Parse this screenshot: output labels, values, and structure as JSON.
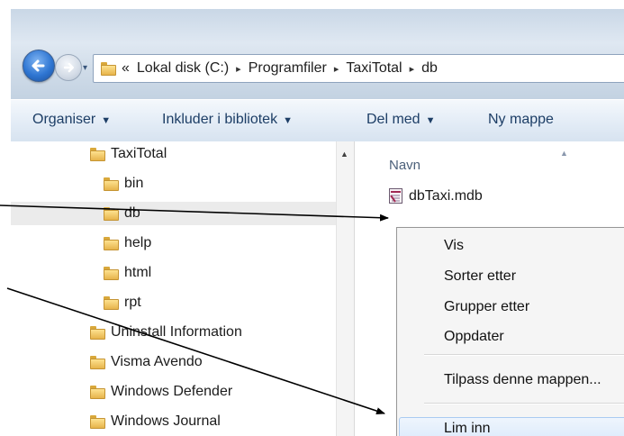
{
  "nav": {
    "history_glyph": "▾"
  },
  "address": {
    "overflow": "«",
    "crumbs": [
      "Lokal disk (C:)",
      "Programfiler",
      "TaxiTotal",
      "db"
    ],
    "sep": "▸"
  },
  "toolbar": {
    "organise": "Organiser",
    "include": "Inkluder i bibliotek",
    "share": "Del med",
    "new_folder": "Ny mappe",
    "dropdown_glyph": "▼"
  },
  "tree": {
    "items": [
      {
        "label": "TaxiTotal",
        "indent": 1
      },
      {
        "label": "bin",
        "indent": 2
      },
      {
        "label": "db",
        "indent": 2,
        "selected": true
      },
      {
        "label": "help",
        "indent": 2
      },
      {
        "label": "html",
        "indent": 2
      },
      {
        "label": "rpt",
        "indent": 2
      },
      {
        "label": "Uninstall Information",
        "indent": 0
      },
      {
        "label": "Visma Avendo",
        "indent": 0
      },
      {
        "label": "Windows Defender",
        "indent": 0
      },
      {
        "label": "Windows Journal",
        "indent": 0
      }
    ]
  },
  "files": {
    "column_name": "Navn",
    "sort_glyph": "▲",
    "items": [
      {
        "name": "dbTaxi.mdb",
        "icon": "access-database-icon"
      }
    ]
  },
  "context_menu": {
    "items": [
      "Vis",
      "Sorter etter",
      "Grupper etter",
      "Oppdater",
      "Tilpass denne mappen...",
      "Lim inn"
    ],
    "highlighted": "Lim inn"
  },
  "colors": {
    "accent": "#1d3e66",
    "selection": "#ebebeb",
    "highlight_border": "#aacbf1"
  }
}
